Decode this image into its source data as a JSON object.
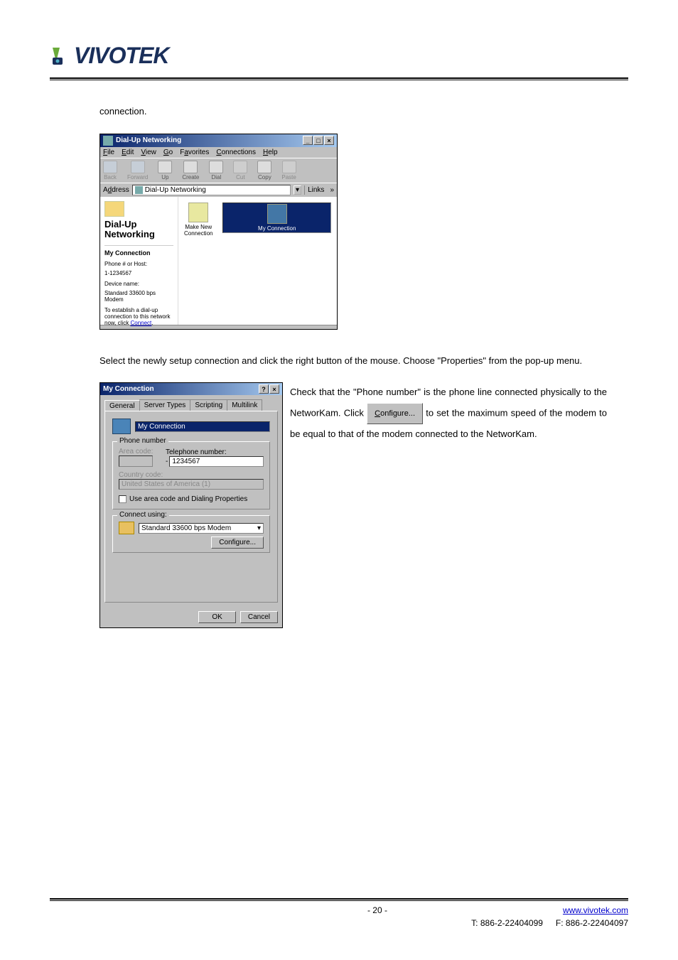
{
  "logo": {
    "text": "VIVOTEK"
  },
  "para_intro": "connection.",
  "dialup_window": {
    "title": "Dial-Up Networking",
    "menus": [
      "File",
      "Edit",
      "View",
      "Go",
      "Favorites",
      "Connections",
      "Help"
    ],
    "toolbar": [
      "Back",
      "Forward",
      "Up",
      "Create",
      "Dial",
      "Cut",
      "Copy",
      "Paste"
    ],
    "address_label": "Address",
    "address_value": "Dial-Up Networking",
    "links_label": "Links",
    "left": {
      "title": "Dial-Up Networking",
      "section": "My Connection",
      "phone_label": "Phone # or Host:",
      "phone_value": "1-1234567",
      "device_label": "Device name:",
      "device_value": "Standard 33600 bps Modem",
      "help_text": "To establish a dial-up connection to this network now, click",
      "help_link": "Connect"
    },
    "icons": {
      "make_new": "Make New Connection",
      "my_conn": "My Connection"
    }
  },
  "para_select": "Select the newly setup connection and click the right button of the mouse. Choose \"Properties\" from the pop-up menu.",
  "myconn_dialog": {
    "title": "My Connection",
    "tabs": [
      "General",
      "Server Types",
      "Scripting",
      "Multilink"
    ],
    "conn_name": "My Connection",
    "group_phone": "Phone number",
    "area_code_label": "Area code:",
    "tel_label": "Telephone number:",
    "tel_value": "1234567",
    "country_label": "Country code:",
    "country_value": "United States of America (1)",
    "chk_area": "Use area code and Dialing Properties",
    "group_connect": "Connect using:",
    "modem": "Standard 33600 bps Modem",
    "configure_btn": "Configure...",
    "ok": "OK",
    "cancel": "Cancel"
  },
  "para_check": "Check that the \"Phone number\" is the phone line connected physically to the NetworKam. Click",
  "configure_ref": "Configure...",
  "para_after_btn": " to set the maximum speed of the modem to be equal to that of the modem connected to the NetworKam.",
  "footer": {
    "page": "- 20 -",
    "url": "www.vivotek.com",
    "tel": "T: 886-2-22404099",
    "fax": "F: 886-2-22404097"
  }
}
